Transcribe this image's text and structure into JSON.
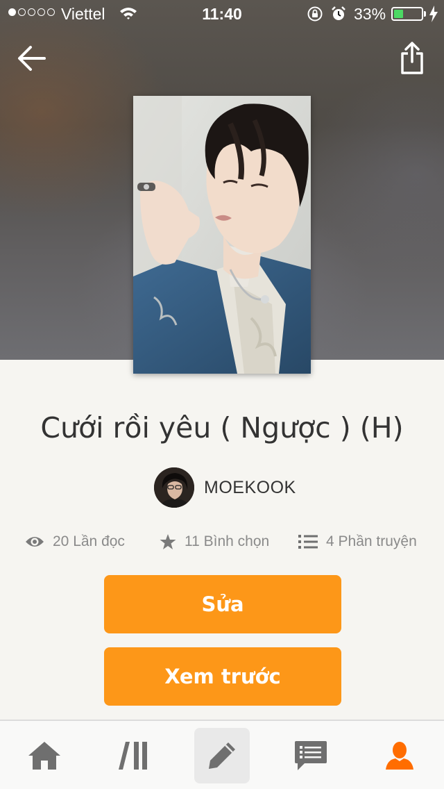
{
  "status_bar": {
    "carrier": "Viettel",
    "time": "11:40",
    "battery": "33%",
    "battery_level": 0.33,
    "signal_bars_filled": 1,
    "signal_bars_total": 5
  },
  "header": {
    "back_icon": "arrow-left-icon",
    "share_icon": "share-icon"
  },
  "story": {
    "title": "Cưới rồi yêu ( Ngược ) (H)",
    "author": "MOEKOOK",
    "stats": {
      "reads": "20 Lần đọc",
      "votes": "11 Bình chọn",
      "parts": "4 Phần truyện"
    }
  },
  "actions": {
    "edit_label": "Sửa",
    "preview_label": "Xem trước"
  },
  "tab_bar": {
    "items": [
      {
        "icon": "home-icon",
        "active": false
      },
      {
        "icon": "library-icon",
        "active": false
      },
      {
        "icon": "pencil-icon",
        "active": true
      },
      {
        "icon": "chat-icon",
        "active": false
      },
      {
        "icon": "profile-icon",
        "active": true
      }
    ]
  },
  "colors": {
    "accent": "#fd9718",
    "background": "#f6f5f1",
    "text": "#333333",
    "muted": "#8a8a8a",
    "icon_gray": "#6f6f6f",
    "profile_orange": "#ff6d00"
  }
}
